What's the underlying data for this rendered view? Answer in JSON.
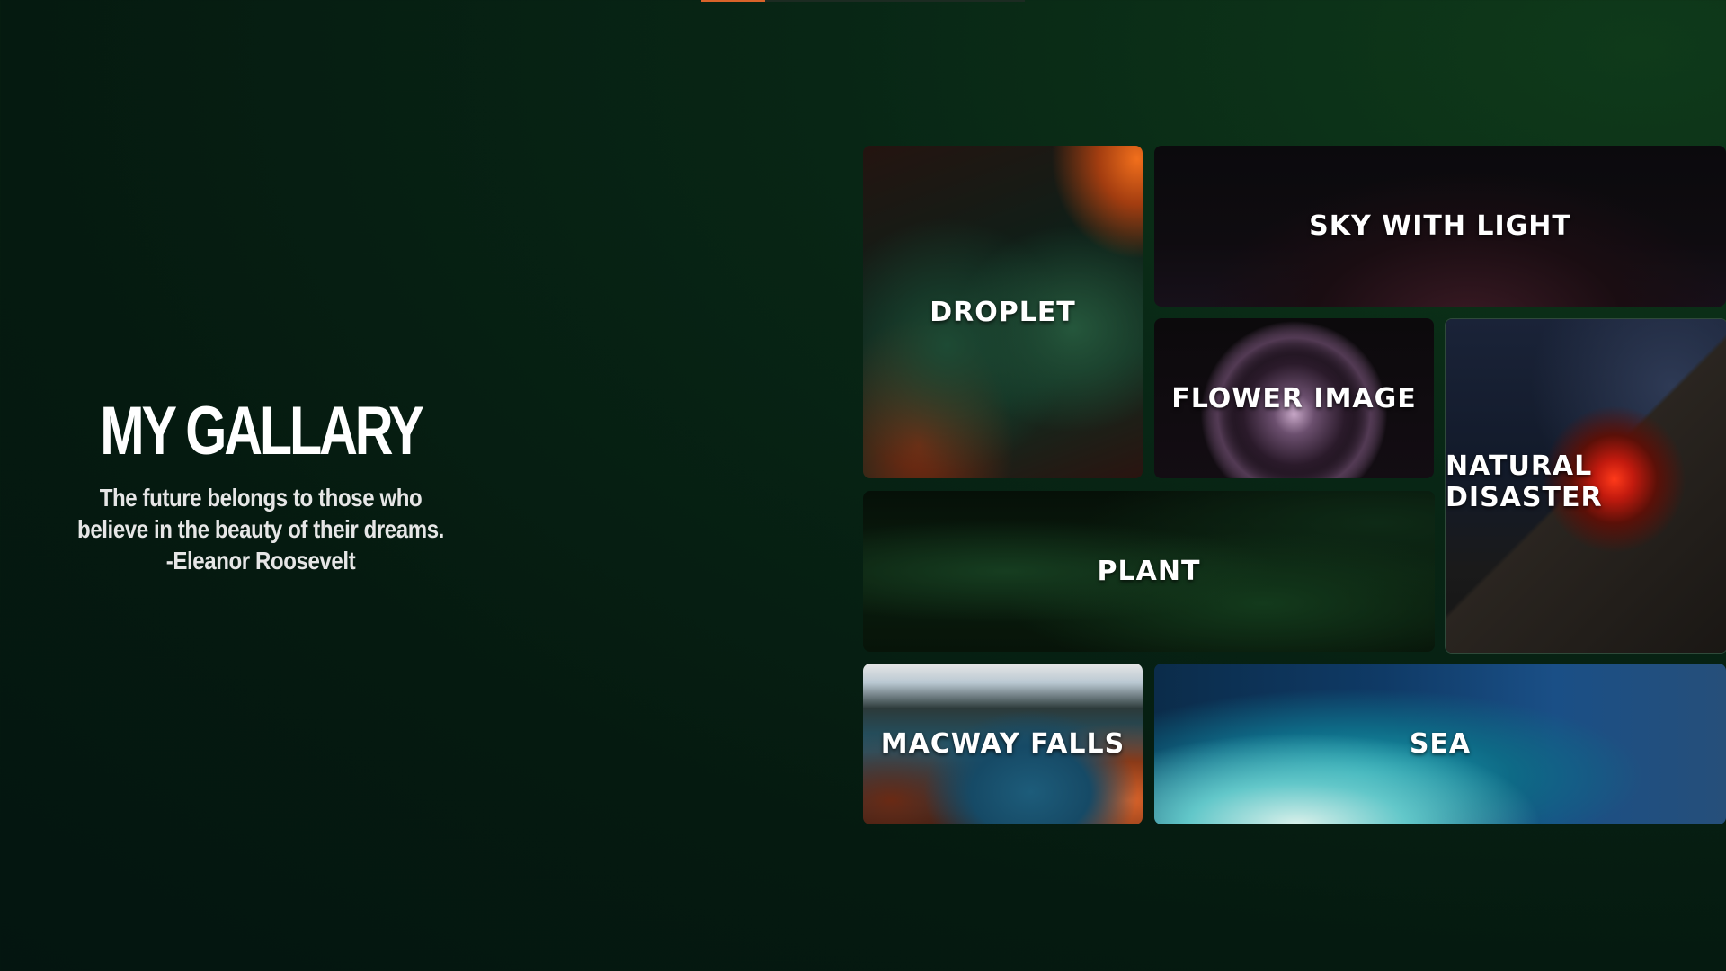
{
  "hero": {
    "title": "MY GALLARY",
    "quote_lines": [
      "The future belongs to those who",
      "believe in the beauty of their dreams.",
      "-Eleanor Roosevelt"
    ]
  },
  "gallery": {
    "tiles": [
      {
        "label": "DROPLET"
      },
      {
        "label": "SKY WITH LIGHT"
      },
      {
        "label": "FLOWER IMAGE"
      },
      {
        "label_lines": [
          "NATURAL",
          "DISASTER"
        ]
      },
      {
        "label": "PLANT"
      },
      {
        "label": "MACWAY FALLS"
      },
      {
        "label": "SEA"
      }
    ]
  },
  "colors": {
    "accent": "#d9632a",
    "background": "#051a10",
    "text": "#ffffff"
  }
}
